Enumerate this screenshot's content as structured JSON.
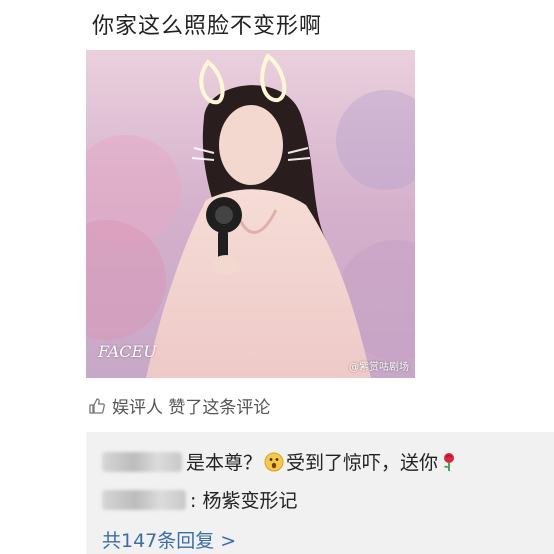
{
  "post": {
    "text": "你家这么照脸不变形啊"
  },
  "photo": {
    "watermark_app": "FACEU",
    "watermark_source": "@紫赏咕剧场"
  },
  "like_row": {
    "text": "娱评人 赞了这条评论"
  },
  "replies": [
    {
      "text": "是本尊？",
      "text2": "受到了惊吓，送你"
    },
    {
      "text": ": 杨紫变形记"
    }
  ],
  "more_replies": {
    "text": "共147条回复 >"
  },
  "colors": {
    "link": "#3a6ea5",
    "reply_bg": "#f1f1f1"
  }
}
